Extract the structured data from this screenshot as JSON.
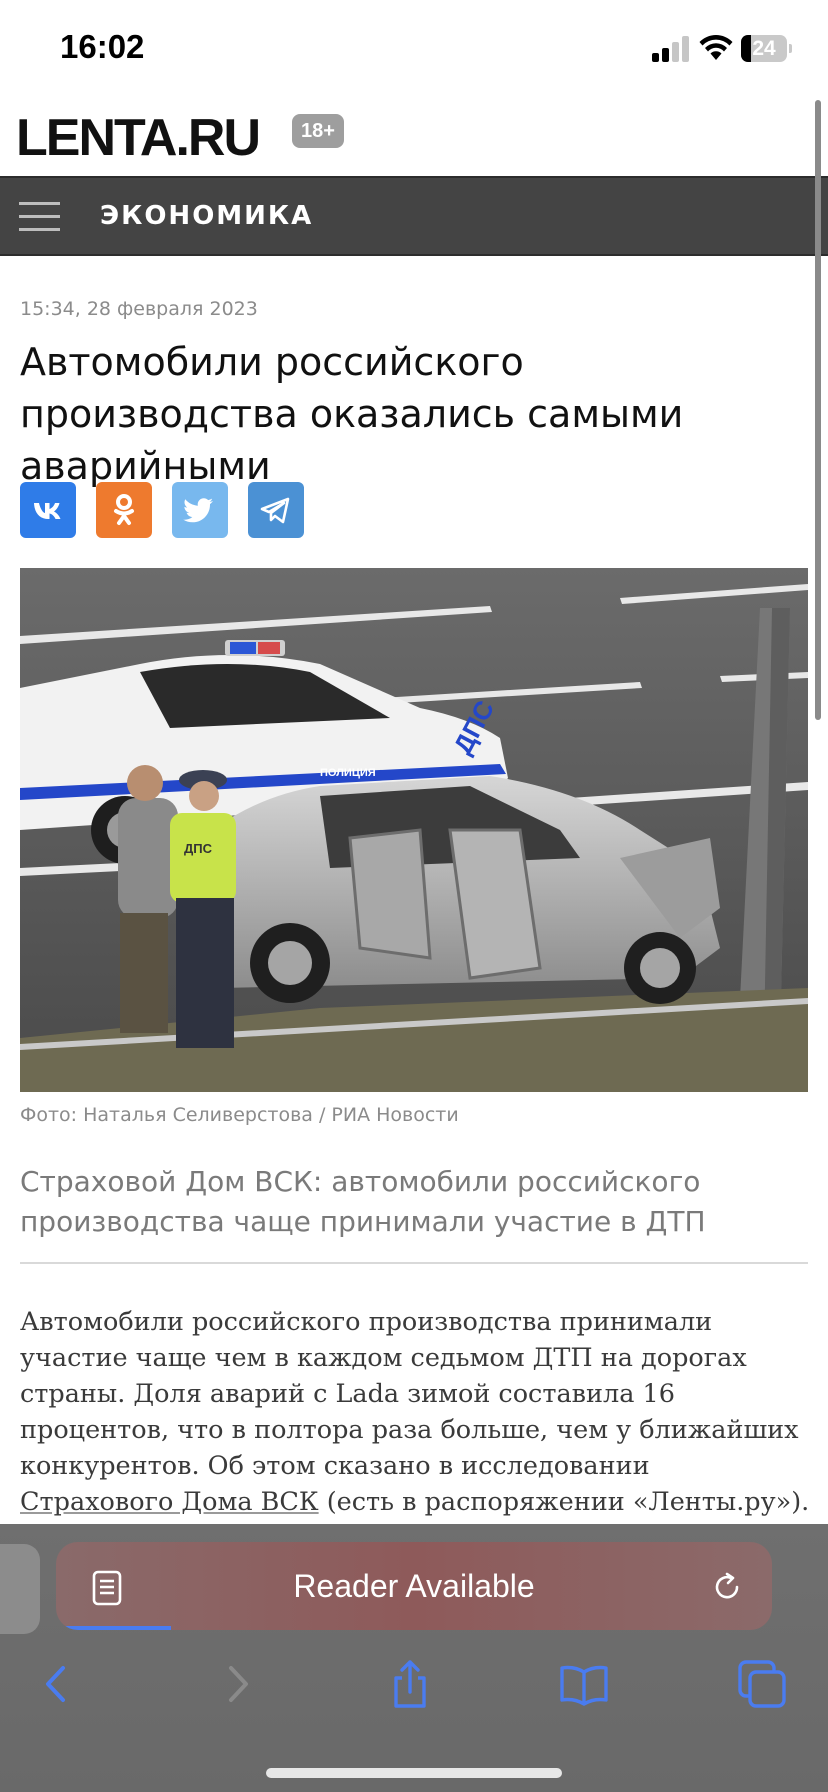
{
  "status_bar": {
    "time": "16:02",
    "battery": "24"
  },
  "site": {
    "logo": "LENTA.RU",
    "age_badge": "18+"
  },
  "nav": {
    "section": "ЭКОНОМИКА"
  },
  "article": {
    "date": "15:34, 28 февраля 2023",
    "headline": "Автомобили российского производства оказались самыми аварийными",
    "photo_caption": "Фото: Наталья Селиверстова / РИА Новости",
    "lead": "Страховой Дом ВСК: автомобили российского производства чаще принимали участие в ДТП",
    "body_part1": "Автомобили российского производства принимали участие чаще чем в каждом седьмом ДТП на дорогах страны. Доля аварий с Lada зимой составила 16 процентов, что в полтора раза больше, чем у ближайших конкурентов. Об этом сказано в исследовании ",
    "body_link": "Страхового Дома ВСК",
    "body_part2": " (есть в распоряжении «Ленты.ру»)."
  },
  "photo": {
    "car_label": "ДПС",
    "stripe_label": "ПОЛИЦИЯ",
    "vest_label": "ДПС"
  },
  "share": [
    {
      "name": "vk",
      "icon": "vk-icon",
      "color": "#2f7ce8"
    },
    {
      "name": "odnoklassniki",
      "icon": "ok-icon",
      "color": "#ee7a2e"
    },
    {
      "name": "twitter",
      "icon": "twitter-icon",
      "color": "#78b8ee"
    },
    {
      "name": "telegram",
      "icon": "telegram-icon",
      "color": "#4b91d4"
    }
  ],
  "browser": {
    "address_text": "Reader Available",
    "page_load_progress": 0.16,
    "toolbar": [
      "back-icon",
      "forward-icon",
      "share-icon",
      "bookmarks-icon",
      "tabs-icon"
    ],
    "accent": "#4a7cf0"
  }
}
